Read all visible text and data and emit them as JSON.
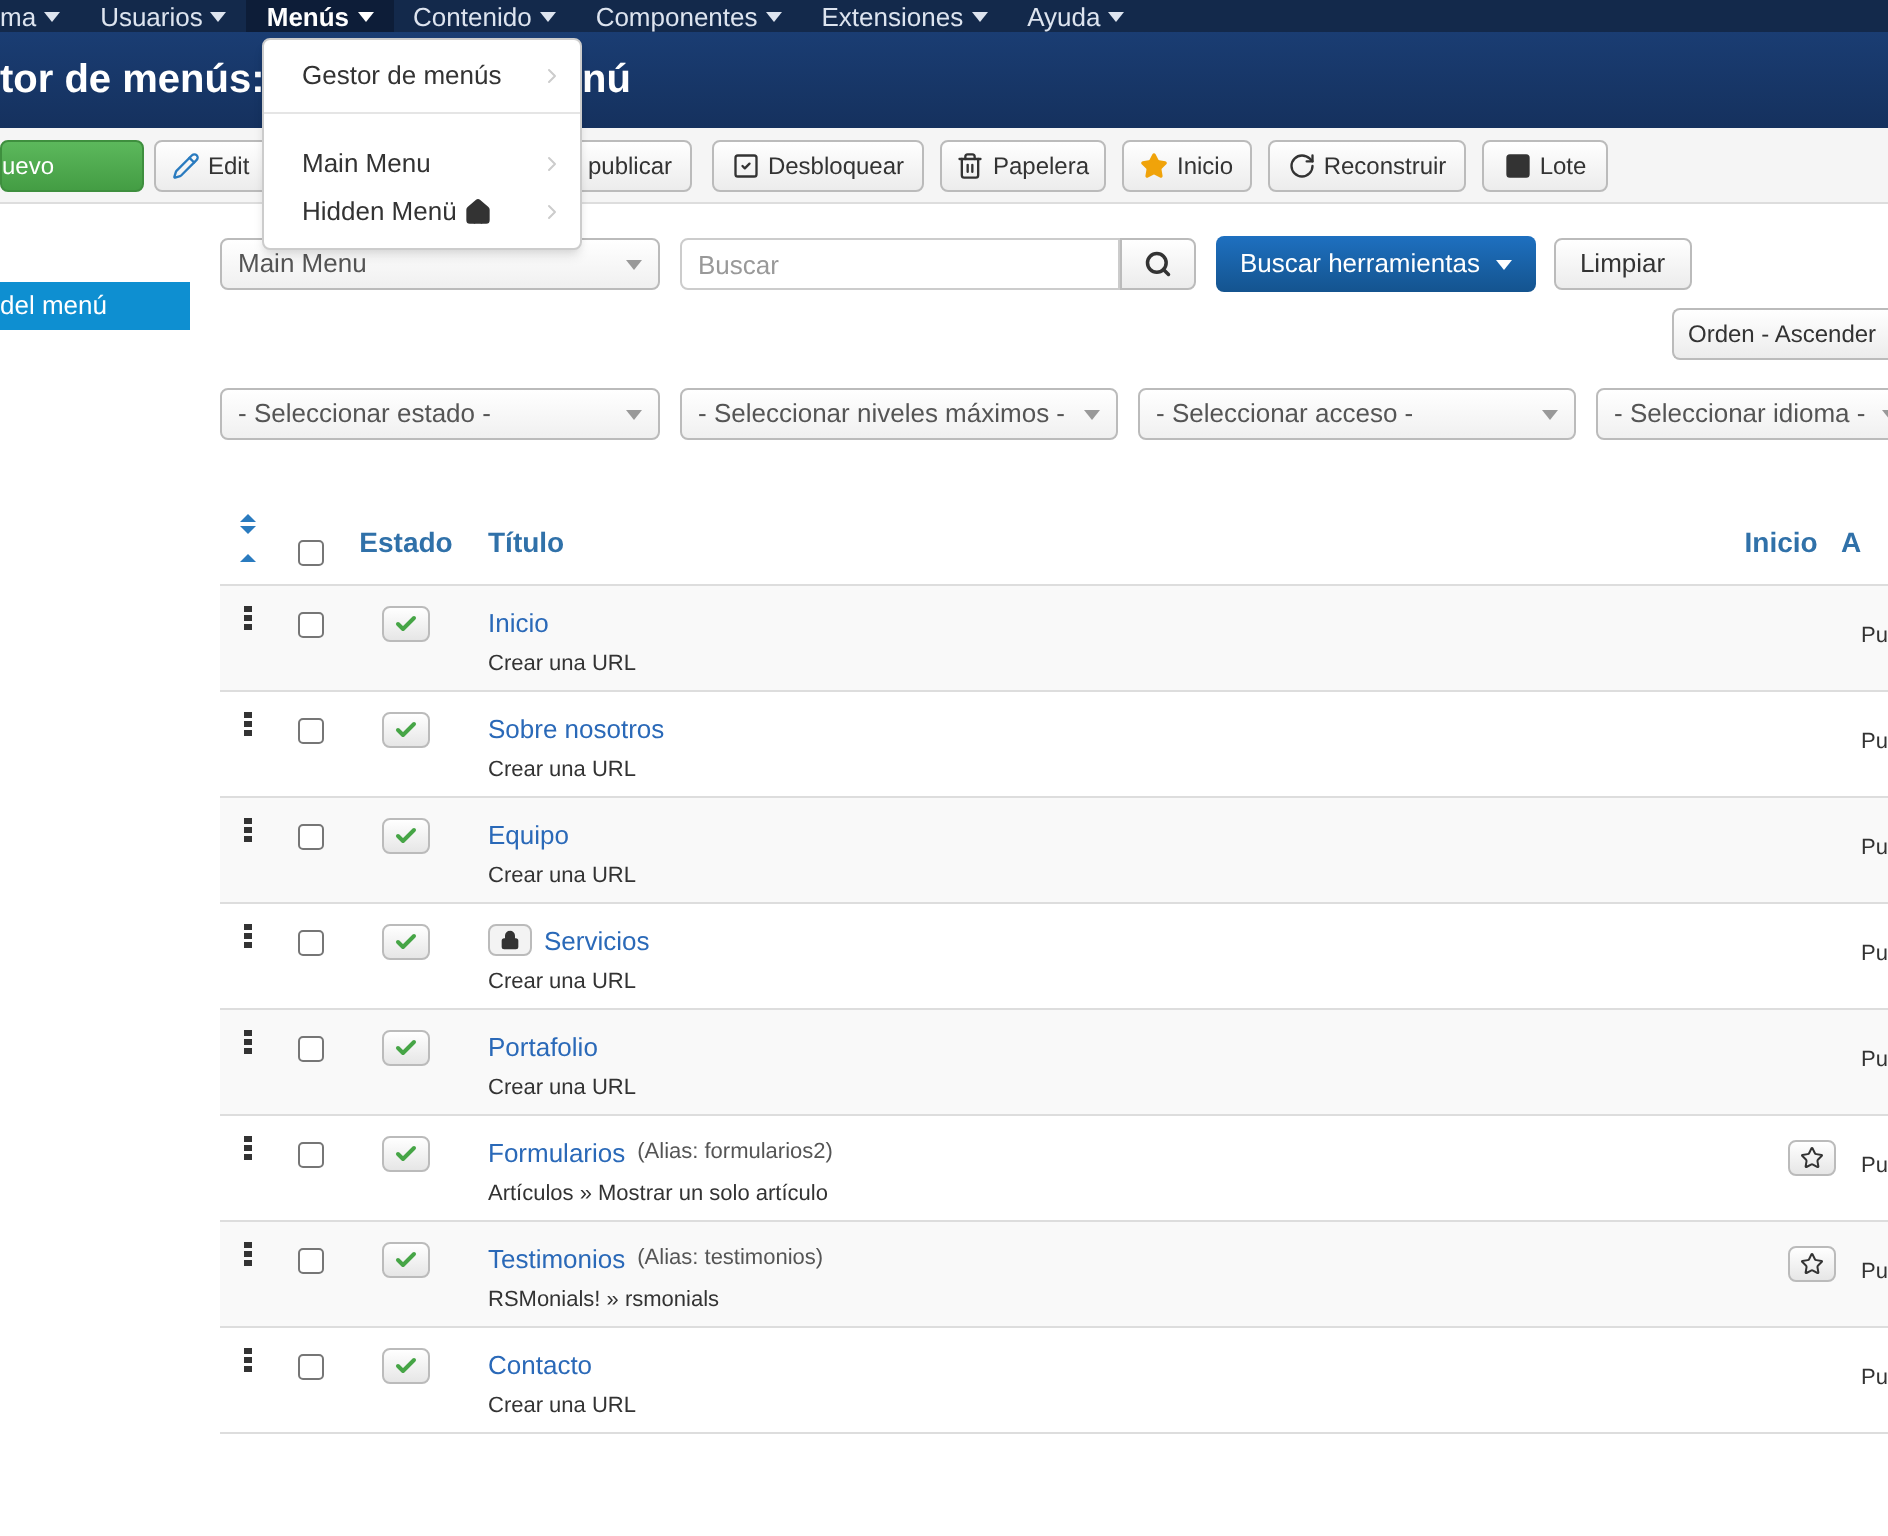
{
  "nav": {
    "items": [
      {
        "label": "ma",
        "open": false
      },
      {
        "label": "Usuarios",
        "open": false
      },
      {
        "label": "Menús",
        "open": true
      },
      {
        "label": "Contenido",
        "open": false
      },
      {
        "label": "Componentes",
        "open": false
      },
      {
        "label": "Extensiones",
        "open": false
      },
      {
        "label": "Ayuda",
        "open": false
      }
    ]
  },
  "dropdown": {
    "groups": [
      [
        {
          "label": "Gestor de menús",
          "home": false
        }
      ],
      [
        {
          "label": "Main Menu",
          "home": false
        },
        {
          "label": "Hidden Menü",
          "home": true
        }
      ]
    ]
  },
  "title": {
    "parts": [
      "tor de menús:",
      "nú"
    ]
  },
  "toolbar": [
    {
      "label": "uevo",
      "kind": "new"
    },
    {
      "label": "Edit",
      "kind": "edit"
    },
    {
      "label": "publicar",
      "kind": "publish"
    },
    {
      "label": "Desbloquear",
      "kind": "unlock"
    },
    {
      "label": "Papelera",
      "kind": "trash"
    },
    {
      "label": "Inicio",
      "kind": "home"
    },
    {
      "label": "Reconstruir",
      "kind": "rebuild"
    },
    {
      "label": "Lote",
      "kind": "batch"
    }
  ],
  "sidebar": {
    "items": [
      {
        "label": "del menú",
        "selected": true
      }
    ]
  },
  "filters": {
    "menu": "Main Menu",
    "search": {
      "placeholder": "Buscar"
    },
    "search_tools": "Buscar herramientas",
    "clear": "Limpiar",
    "order": "Orden - Ascender",
    "selects": [
      "- Seleccionar estado -",
      "- Seleccionar niveles máximos -",
      "- Seleccionar acceso -",
      "- Seleccionar idioma -"
    ]
  },
  "table": {
    "select_all_checked": false,
    "columns": [
      "Estado",
      "Título",
      "Inicio",
      "A"
    ],
    "rows": [
      {
        "title": "Inicio",
        "subtitle": "Crear una URL",
        "published": true,
        "locked": false,
        "home_button": false,
        "checked": false,
        "column_4": "Pu"
      },
      {
        "title": "Sobre nosotros",
        "subtitle": "Crear una URL",
        "published": true,
        "locked": false,
        "home_button": false,
        "checked": false,
        "column_4": "Pu"
      },
      {
        "title": "Equipo",
        "subtitle": "Crear una URL",
        "published": true,
        "locked": false,
        "home_button": false,
        "checked": false,
        "column_4": "Pu"
      },
      {
        "title": "Servicios",
        "subtitle": "Crear una URL",
        "published": true,
        "locked": true,
        "home_button": false,
        "checked": false,
        "column_4": "Pu"
      },
      {
        "title": "Portafolio",
        "subtitle": "Crear una URL",
        "published": true,
        "locked": false,
        "home_button": false,
        "checked": false,
        "column_4": "Pu"
      },
      {
        "title": "Formularios",
        "alias": "(Alias: formularios2)",
        "subtitle": "Artículos » Mostrar un solo artículo",
        "published": true,
        "locked": false,
        "home_button": true,
        "checked": false,
        "column_4": "Pu"
      },
      {
        "title": "Testimonios",
        "alias": "(Alias: testimonios)",
        "subtitle": "RSMonials! » rsmonials",
        "published": true,
        "locked": false,
        "home_button": true,
        "checked": false,
        "column_4": "Pu"
      },
      {
        "title": "Contacto",
        "subtitle": "Crear una URL",
        "published": true,
        "locked": false,
        "home_button": false,
        "checked": false,
        "column_4": "Pu"
      }
    ]
  }
}
